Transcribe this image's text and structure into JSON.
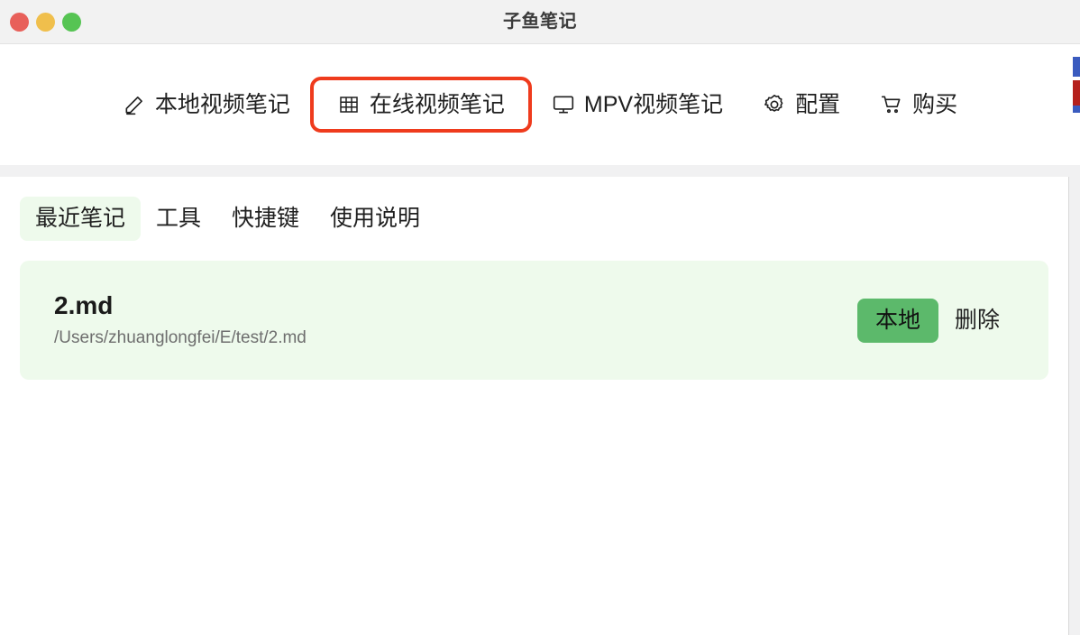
{
  "window": {
    "title": "子鱼笔记",
    "traffic_lights": [
      {
        "name": "close",
        "color": "#e8605a"
      },
      {
        "name": "minimize",
        "color": "#f0bf4c"
      },
      {
        "name": "maximize",
        "color": "#56c453"
      }
    ]
  },
  "nav": {
    "highlight_color": "#ef3b1d",
    "items": [
      {
        "label": "本地视频笔记",
        "icon": "pencil-icon",
        "highlighted": false
      },
      {
        "label": "在线视频笔记",
        "icon": "grid-icon",
        "highlighted": true
      },
      {
        "label": "MPV视频笔记",
        "icon": "monitor-icon",
        "highlighted": false
      },
      {
        "label": "配置",
        "icon": "gear-icon",
        "highlighted": false
      },
      {
        "label": "购买",
        "icon": "cart-icon",
        "highlighted": false
      }
    ]
  },
  "tabs": {
    "active_bg": "#eefaec",
    "items": [
      {
        "label": "最近笔记",
        "active": true
      },
      {
        "label": "工具",
        "active": false
      },
      {
        "label": "快捷键",
        "active": false
      },
      {
        "label": "使用说明",
        "active": false
      }
    ]
  },
  "notes": {
    "card_bg": "#eefaec",
    "items": [
      {
        "title": "2.md",
        "path": "/Users/zhuanglongfei/E/test/2.md",
        "primary_action": "本地",
        "primary_action_color": "#5cb96b",
        "secondary_action": "删除"
      }
    ]
  }
}
